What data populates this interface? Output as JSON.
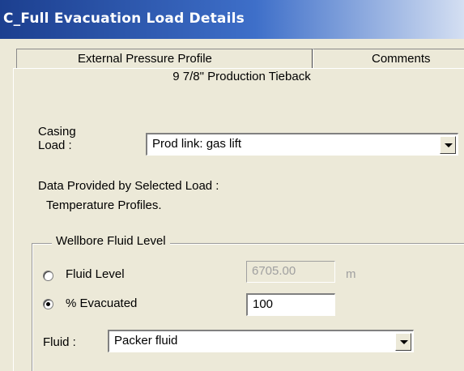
{
  "window": {
    "title": "C_Full Evacuation Load Details"
  },
  "tabs": [
    {
      "label": "External Pressure Profile"
    },
    {
      "label": "Comments"
    }
  ],
  "section_title": "9 7/8\" Production Tieback",
  "casing_load": {
    "label_line1": "Casing",
    "label_line2": "Load :",
    "value": "Prod link: gas lift"
  },
  "data_provided": {
    "label": "Data Provided by Selected Load :",
    "value": "Temperature  Profiles."
  },
  "wellbore_fluid_level": {
    "group_label": "Wellbore Fluid Level",
    "fluid_level": {
      "label": "Fluid Level",
      "value": "6705.00",
      "unit": "m",
      "selected": false,
      "enabled": false
    },
    "percent_evacuated": {
      "label": "% Evacuated",
      "value": "100",
      "selected": true
    },
    "fluid": {
      "label": "Fluid :",
      "value": "Packer fluid"
    }
  }
}
